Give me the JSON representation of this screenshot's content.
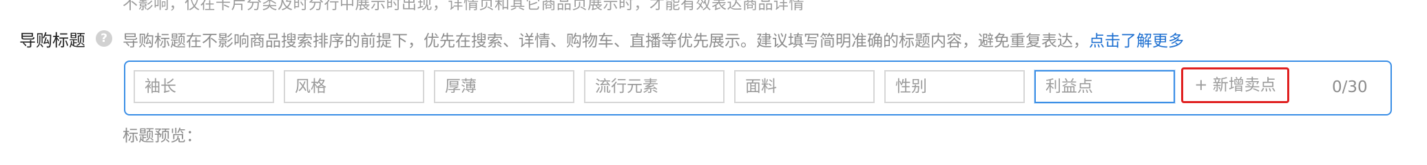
{
  "top_partial_text": "不影响，仅在卡片分类及时分行中展示时出现，详情页和其它商品页展示时，才能有效表达商品详情",
  "field": {
    "label": "导购标题",
    "help_icon_glyph": "?",
    "help_text": "导购标题在不影响商品搜索排序的前提下，优先在搜索、详情、购物车、直播等优先展示。建议填写简明准确的标题内容，避免重复表达，",
    "help_link": "点击了解更多"
  },
  "tags": [
    {
      "placeholder": "袖长"
    },
    {
      "placeholder": "风格"
    },
    {
      "placeholder": "厚薄"
    },
    {
      "placeholder": "流行元素"
    },
    {
      "placeholder": "面料"
    },
    {
      "placeholder": "性别"
    },
    {
      "placeholder": "利益点"
    }
  ],
  "add_button_label": "+ 新增卖点",
  "counter": "0/30",
  "preview_label": "标题预览：",
  "colors": {
    "link": "#1d6fd0",
    "focus_border": "#3a8ee6",
    "highlight": "#e02020"
  }
}
